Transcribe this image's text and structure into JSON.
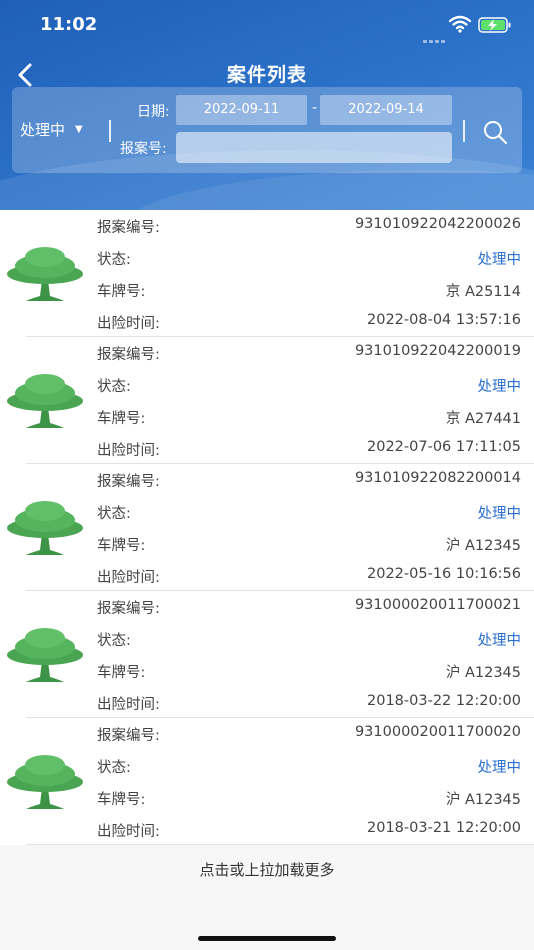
{
  "status_bar": {
    "time": "11:02"
  },
  "nav": {
    "title": "案件列表"
  },
  "filter": {
    "status_value": "处理中",
    "date_label": "日期:",
    "date_start": "2022-09-11",
    "date_separator": "-",
    "date_end": "2022-09-14",
    "case_no_label": "报案号:",
    "case_no_value": ""
  },
  "labels": {
    "case_no": "报案编号:",
    "status": "状态:",
    "plate": "车牌号:",
    "time": "出险时间:"
  },
  "cases": [
    {
      "case_no": "931010922042200026",
      "status": "处理中",
      "plate": "京 A25114",
      "time": "2022-08-04 13:57:16"
    },
    {
      "case_no": "931010922042200019",
      "status": "处理中",
      "plate": "京 A27441",
      "time": "2022-07-06 17:11:05"
    },
    {
      "case_no": "931010922082200014",
      "status": "处理中",
      "plate": "沪 A12345",
      "time": "2022-05-16 10:16:56"
    },
    {
      "case_no": "931000020011700021",
      "status": "处理中",
      "plate": "沪 A12345",
      "time": "2018-03-22 12:20:00"
    },
    {
      "case_no": "931000020011700020",
      "status": "处理中",
      "plate": "沪 A12345",
      "time": "2018-03-21 12:20:00"
    }
  ],
  "footer": {
    "load_more": "点击或上拉加载更多"
  },
  "colors": {
    "header": "#2a6fc6",
    "status_text": "#2b6fd0",
    "logo_green": "#3f9a4a"
  },
  "icons": [
    "back-arrow-icon",
    "search-icon",
    "wifi-icon",
    "battery-charging-icon",
    "tree-logo-icon"
  ]
}
